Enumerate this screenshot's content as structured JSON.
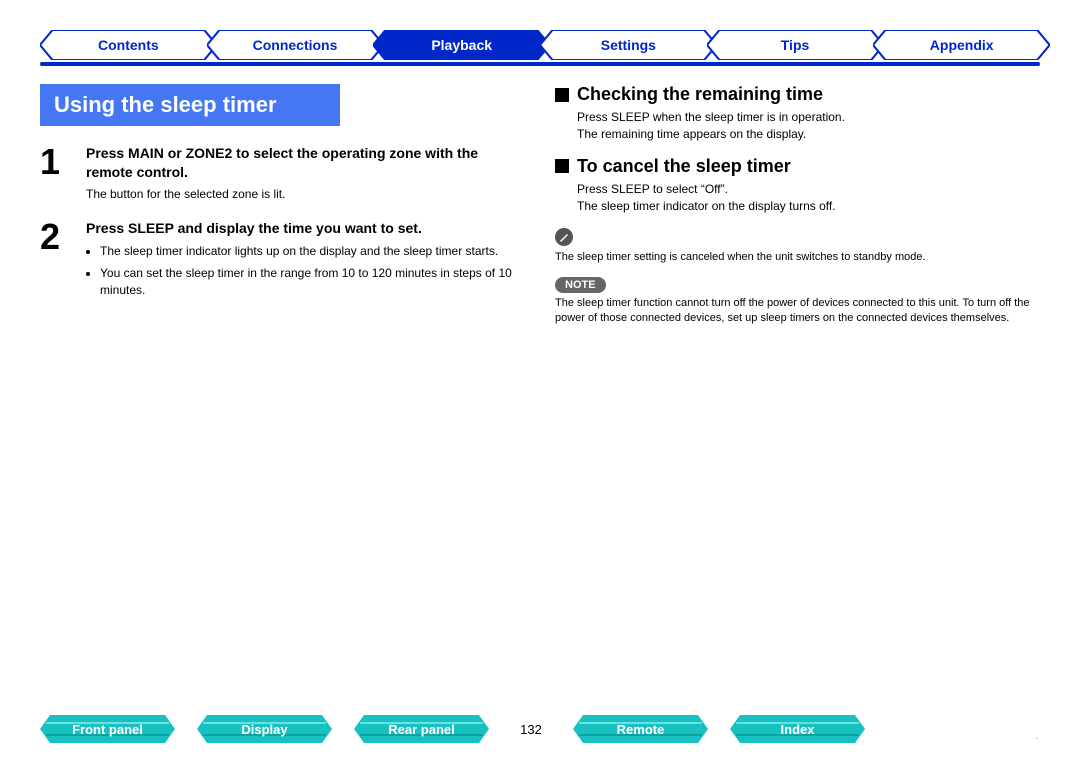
{
  "topnav": {
    "items": [
      {
        "label": "Contents",
        "active": false
      },
      {
        "label": "Connections",
        "active": false
      },
      {
        "label": "Playback",
        "active": true
      },
      {
        "label": "Settings",
        "active": false
      },
      {
        "label": "Tips",
        "active": false
      },
      {
        "label": "Appendix",
        "active": false
      }
    ]
  },
  "section_title": "Using the sleep timer",
  "steps": [
    {
      "num": "1",
      "head": "Press MAIN or ZONE2 to select the operating zone with the remote control.",
      "sub": "The button for the selected zone is lit.",
      "bullets": []
    },
    {
      "num": "2",
      "head": "Press SLEEP and display the time you want to set.",
      "sub": "",
      "bullets": [
        "The sleep timer indicator lights up on the display and the sleep timer starts.",
        "You can set the sleep timer in the range from 10 to 120 minutes in steps of 10 minutes."
      ]
    }
  ],
  "right": {
    "check": {
      "title": "Checking the remaining time",
      "body": "Press SLEEP when the sleep timer is in operation.\nThe remaining time appears on the display."
    },
    "cancel": {
      "title": "To cancel the sleep timer",
      "body": "Press SLEEP to select “Off”.\nThe sleep timer indicator on the display turns off."
    },
    "pencil_note": "The sleep timer setting is canceled when the unit switches to standby mode.",
    "note_badge": "NOTE",
    "note_text": "The sleep timer function cannot turn off the power of devices connected to this unit. To turn off the power of those connected devices, set up sleep timers on the connected devices themselves."
  },
  "bottomnav": {
    "items": [
      "Front panel",
      "Display",
      "Rear panel"
    ],
    "page": "132",
    "items2": [
      "Remote",
      "Index"
    ]
  },
  "colors": {
    "accent": "#0028c8",
    "section": "#4577f5",
    "bottom": "#18c1c1"
  }
}
